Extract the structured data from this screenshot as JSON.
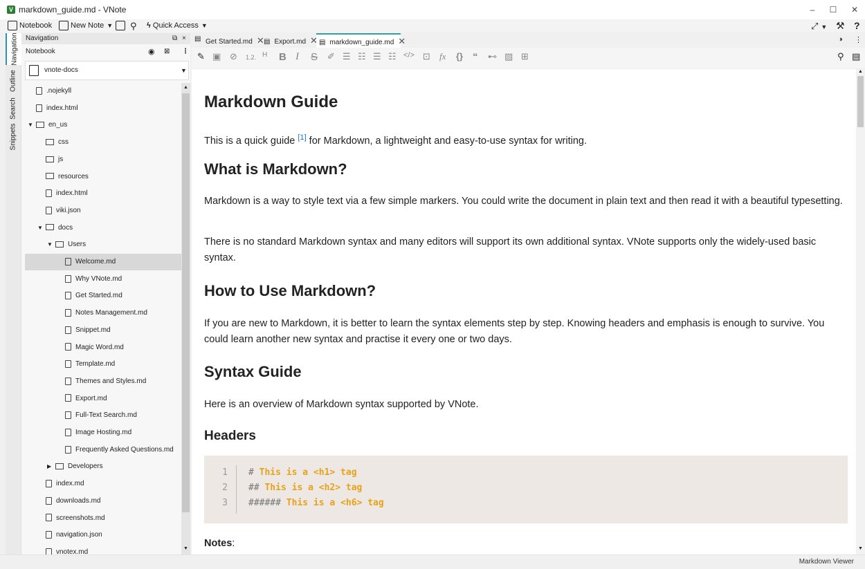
{
  "window": {
    "title": "markdown_guide.md - VNote",
    "minimize": "–",
    "maximize": "☐",
    "close": "✕"
  },
  "toolbar": {
    "notebook": "Notebook",
    "new_note": "New Note",
    "quick_access": "Quick Access"
  },
  "side_tabs": [
    "Navigation",
    "Outline",
    "Search",
    "Snippets"
  ],
  "nav": {
    "header": "Navigation",
    "notebook_label": "Notebook",
    "selected_notebook": "vnote-docs",
    "tree": [
      {
        "label": ".nojekyll",
        "type": "file",
        "depth": 0
      },
      {
        "label": "index.html",
        "type": "file",
        "depth": 0
      },
      {
        "label": "en_us",
        "type": "dir",
        "depth": 0,
        "expanded": true
      },
      {
        "label": "css",
        "type": "dir",
        "depth": 1
      },
      {
        "label": "js",
        "type": "dir",
        "depth": 1
      },
      {
        "label": "resources",
        "type": "dir",
        "depth": 1
      },
      {
        "label": "index.html",
        "type": "file",
        "depth": 1
      },
      {
        "label": "viki.json",
        "type": "file",
        "depth": 1
      },
      {
        "label": "docs",
        "type": "dir",
        "depth": 1,
        "expanded": true
      },
      {
        "label": "Users",
        "type": "dir",
        "depth": 2,
        "expanded": true
      },
      {
        "label": "Welcome.md",
        "type": "file",
        "depth": 3,
        "selected": true
      },
      {
        "label": "Why VNote.md",
        "type": "file",
        "depth": 3
      },
      {
        "label": "Get Started.md",
        "type": "file",
        "depth": 3
      },
      {
        "label": "Notes Management.md",
        "type": "file",
        "depth": 3
      },
      {
        "label": "Snippet.md",
        "type": "file",
        "depth": 3
      },
      {
        "label": "Magic Word.md",
        "type": "file",
        "depth": 3
      },
      {
        "label": "Template.md",
        "type": "file",
        "depth": 3
      },
      {
        "label": "Themes and Styles.md",
        "type": "file",
        "depth": 3
      },
      {
        "label": "Export.md",
        "type": "file",
        "depth": 3
      },
      {
        "label": "Full-Text Search.md",
        "type": "file",
        "depth": 3
      },
      {
        "label": "Image Hosting.md",
        "type": "file",
        "depth": 3
      },
      {
        "label": "Frequently Asked Questions.md",
        "type": "file",
        "depth": 3
      },
      {
        "label": "Developers",
        "type": "dir",
        "depth": 2,
        "expanded": false
      },
      {
        "label": "index.md",
        "type": "file",
        "depth": 1
      },
      {
        "label": "downloads.md",
        "type": "file",
        "depth": 1
      },
      {
        "label": "screenshots.md",
        "type": "file",
        "depth": 1
      },
      {
        "label": "navigation.json",
        "type": "file",
        "depth": 1
      },
      {
        "label": "vnotex.md",
        "type": "file",
        "depth": 1
      }
    ]
  },
  "tabs": [
    {
      "label": "Get Started.md",
      "active": false
    },
    {
      "label": "Export.md",
      "active": false
    },
    {
      "label": "markdown_guide.md",
      "active": true
    }
  ],
  "doc": {
    "h1": "Markdown Guide",
    "intro_before": "This is a quick guide ",
    "intro_fn": "[1]",
    "intro_after": " for Markdown, a lightweight and easy-to-use syntax for writing.",
    "h2_what": "What is Markdown?",
    "p_what": "Markdown is a way to style text via a few simple markers. You could write the document in plain text and then read it with a beautiful typesetting.",
    "p_standard": "There is no standard Markdown syntax and many editors will support its own additional syntax. VNote supports only the widely-used basic syntax.",
    "h2_how": "How to Use Markdown?",
    "p_how": "If you are new to Markdown, it is better to learn the syntax elements step by step. Knowing headers and emphasis is enough to survive. You could learn another new syntax and practise it every one or two days.",
    "h2_syntax": "Syntax Guide",
    "p_syntax": "Here is an overview of Markdown syntax supported by VNote.",
    "h3_headers": "Headers",
    "code": [
      {
        "num": "1",
        "hash": "#",
        "text": "This is a <h1> tag"
      },
      {
        "num": "2",
        "hash": "##",
        "text": "This is a <h2> tag"
      },
      {
        "num": "3",
        "hash": "######",
        "text": "This is a <h6> tag"
      }
    ],
    "notes_label": "Notes",
    "notes_colon": ":"
  },
  "status": {
    "mode": "Markdown Viewer"
  }
}
